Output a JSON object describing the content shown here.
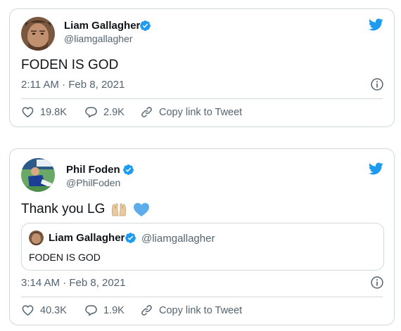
{
  "colors": {
    "accent": "#1d9bf0",
    "text": "#0f1419",
    "muted": "#536471",
    "border": "#cfd9de"
  },
  "icons": [
    "twitter-bird-icon",
    "verified-badge-icon",
    "info-icon",
    "heart-icon",
    "reply-icon",
    "link-icon"
  ],
  "tweets": [
    {
      "name": "Liam Gallagher",
      "handle": "@liamgallagher",
      "text": "FODEN IS GOD",
      "timestamp": "2:11 AM · Feb 8, 2021",
      "likes": "19.8K",
      "replies": "2.9K",
      "copy_link": "Copy link to Tweet"
    },
    {
      "name": "Phil Foden",
      "handle": "@PhilFoden",
      "text": "Thank you LG",
      "emoji": "🙌🏼💙",
      "quote": {
        "name": "Liam Gallagher",
        "handle": "@liamgallagher",
        "text": "FODEN IS GOD"
      },
      "timestamp": "3:14 AM · Feb 8, 2021",
      "likes": "40.3K",
      "replies": "1.9K",
      "copy_link": "Copy link to Tweet"
    }
  ]
}
